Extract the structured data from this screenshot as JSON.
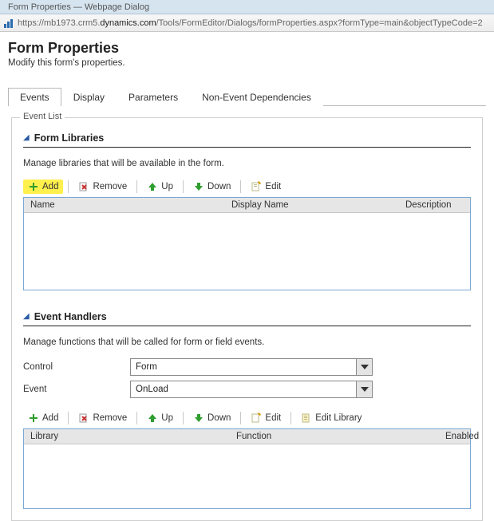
{
  "titlebar_fragment": "Form Properties — Webpage Dialog",
  "url": {
    "prefix": "https://mb1973.crm5.",
    "host_strong": "dynamics.com",
    "path": "/Tools/FormEditor/Dialogs/formProperties.aspx?formType=main&objectTypeCode=2"
  },
  "page": {
    "title": "Form Properties",
    "subtitle": "Modify this form's properties."
  },
  "tabs": {
    "events": "Events",
    "display": "Display",
    "parameters": "Parameters",
    "non_event_deps": "Non-Event Dependencies"
  },
  "section_legend": "Event List",
  "libs": {
    "heading": "Form Libraries",
    "desc": "Manage libraries that will be available in the form.",
    "cols": {
      "name": "Name",
      "display_name": "Display Name",
      "description": "Description"
    }
  },
  "handlers": {
    "heading": "Event Handlers",
    "desc": "Manage functions that will be called for form or field events.",
    "control_label": "Control",
    "control_value": "Form",
    "event_label": "Event",
    "event_value": "OnLoad",
    "cols": {
      "library": "Library",
      "function": "Function",
      "enabled": "Enabled"
    }
  },
  "toolbar": {
    "add": "Add",
    "remove": "Remove",
    "up": "Up",
    "down": "Down",
    "edit": "Edit",
    "edit_library": "Edit Library"
  }
}
